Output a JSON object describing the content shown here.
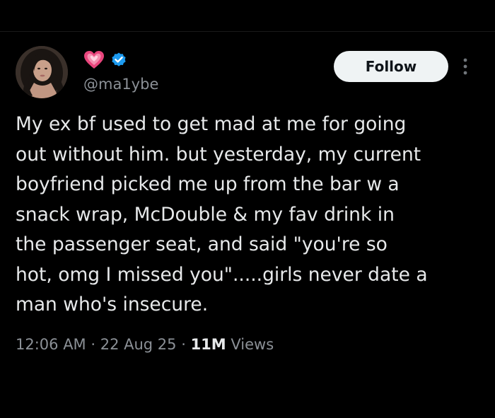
{
  "tweet": {
    "author": {
      "handle": "@ma1ybe",
      "icons": [
        "heart-emoji-icon",
        "verified-badge-icon"
      ],
      "badge_color": "#1d9bf0",
      "heart_color": "#e8457c"
    },
    "follow_label": "Follow",
    "text": "My ex bf used to get mad at me for going\nout without him. but yesterday, my current\nboyfriend picked me up from the bar w a\nsnack wrap, McDouble & my fav drink in\nthe passenger seat, and said \"you're so\nhot, omg I missed you\".....girls never date a\nman who's insecure.",
    "time": "12:06 AM",
    "date": "22 Aug 25",
    "separator": " · ",
    "views_count": "11M",
    "views_label": "Views"
  }
}
